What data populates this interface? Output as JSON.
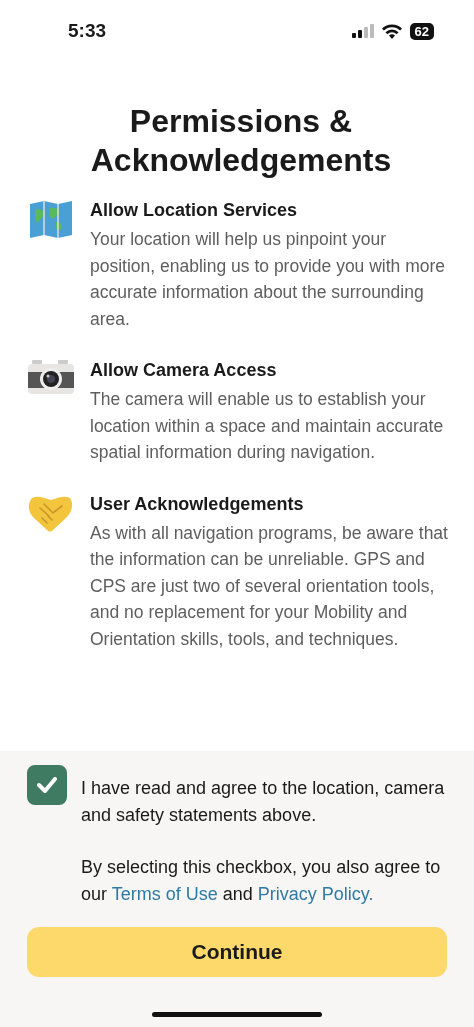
{
  "status_bar": {
    "time": "5:33",
    "battery": "62"
  },
  "title": "Permissions & Acknowledgements",
  "sections": [
    {
      "kind": "map",
      "title": "Allow Location Services",
      "body": "Your location will help us pinpoint your position, enabling us to provide you with more accurate information about the surrounding area."
    },
    {
      "kind": "camera",
      "title": "Allow Camera Access",
      "body": "The camera will enable us to establish your location within a space and maintain accurate spatial information during navigation."
    },
    {
      "kind": "handshake",
      "title": "User Acknowledgements",
      "body": "As with all navigation programs, be aware that the information can be unreliable. GPS and CPS are just two of several orientation tools, and no replacement for your Mobility and Orientation skills, tools, and techniques."
    }
  ],
  "agreement": {
    "checked": true,
    "statement": "I have read and agree to the location, camera and safety statements above.",
    "note": [
      {
        "kind": "text",
        "text": "By selecting this checkbox, you also agree to our "
      },
      {
        "kind": "link",
        "text": "Terms of Use"
      },
      {
        "kind": "text",
        "text": " and "
      },
      {
        "kind": "link",
        "text": "Privacy Policy."
      }
    ]
  },
  "button": "Continue"
}
